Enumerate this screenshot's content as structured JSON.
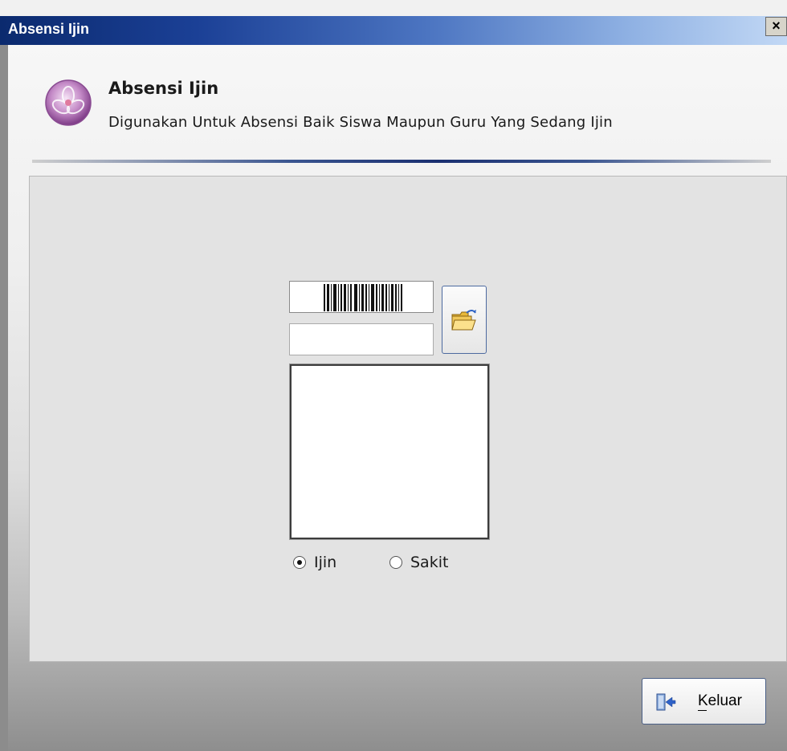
{
  "window": {
    "title": "Absensi Ijin",
    "close_glyph": "×"
  },
  "header": {
    "title": "Absensi Ijin",
    "subtitle": "Digunakan Untuk Absensi Baik Siswa Maupun Guru Yang Sedang Ijin",
    "icon": "flower-logo-icon"
  },
  "form": {
    "barcode_icon": "barcode-icon",
    "id_value": "",
    "open_icon": "open-folder-icon",
    "status_options": [
      {
        "label": "Ijin",
        "selected": true
      },
      {
        "label": "Sakit",
        "selected": false
      }
    ]
  },
  "footer": {
    "exit_label": "Keluar",
    "exit_icon": "exit-door-icon"
  },
  "colors": {
    "titlebar_start": "#0b2a6e",
    "titlebar_end": "#c2d8f5",
    "accent": "#1a2f70"
  }
}
